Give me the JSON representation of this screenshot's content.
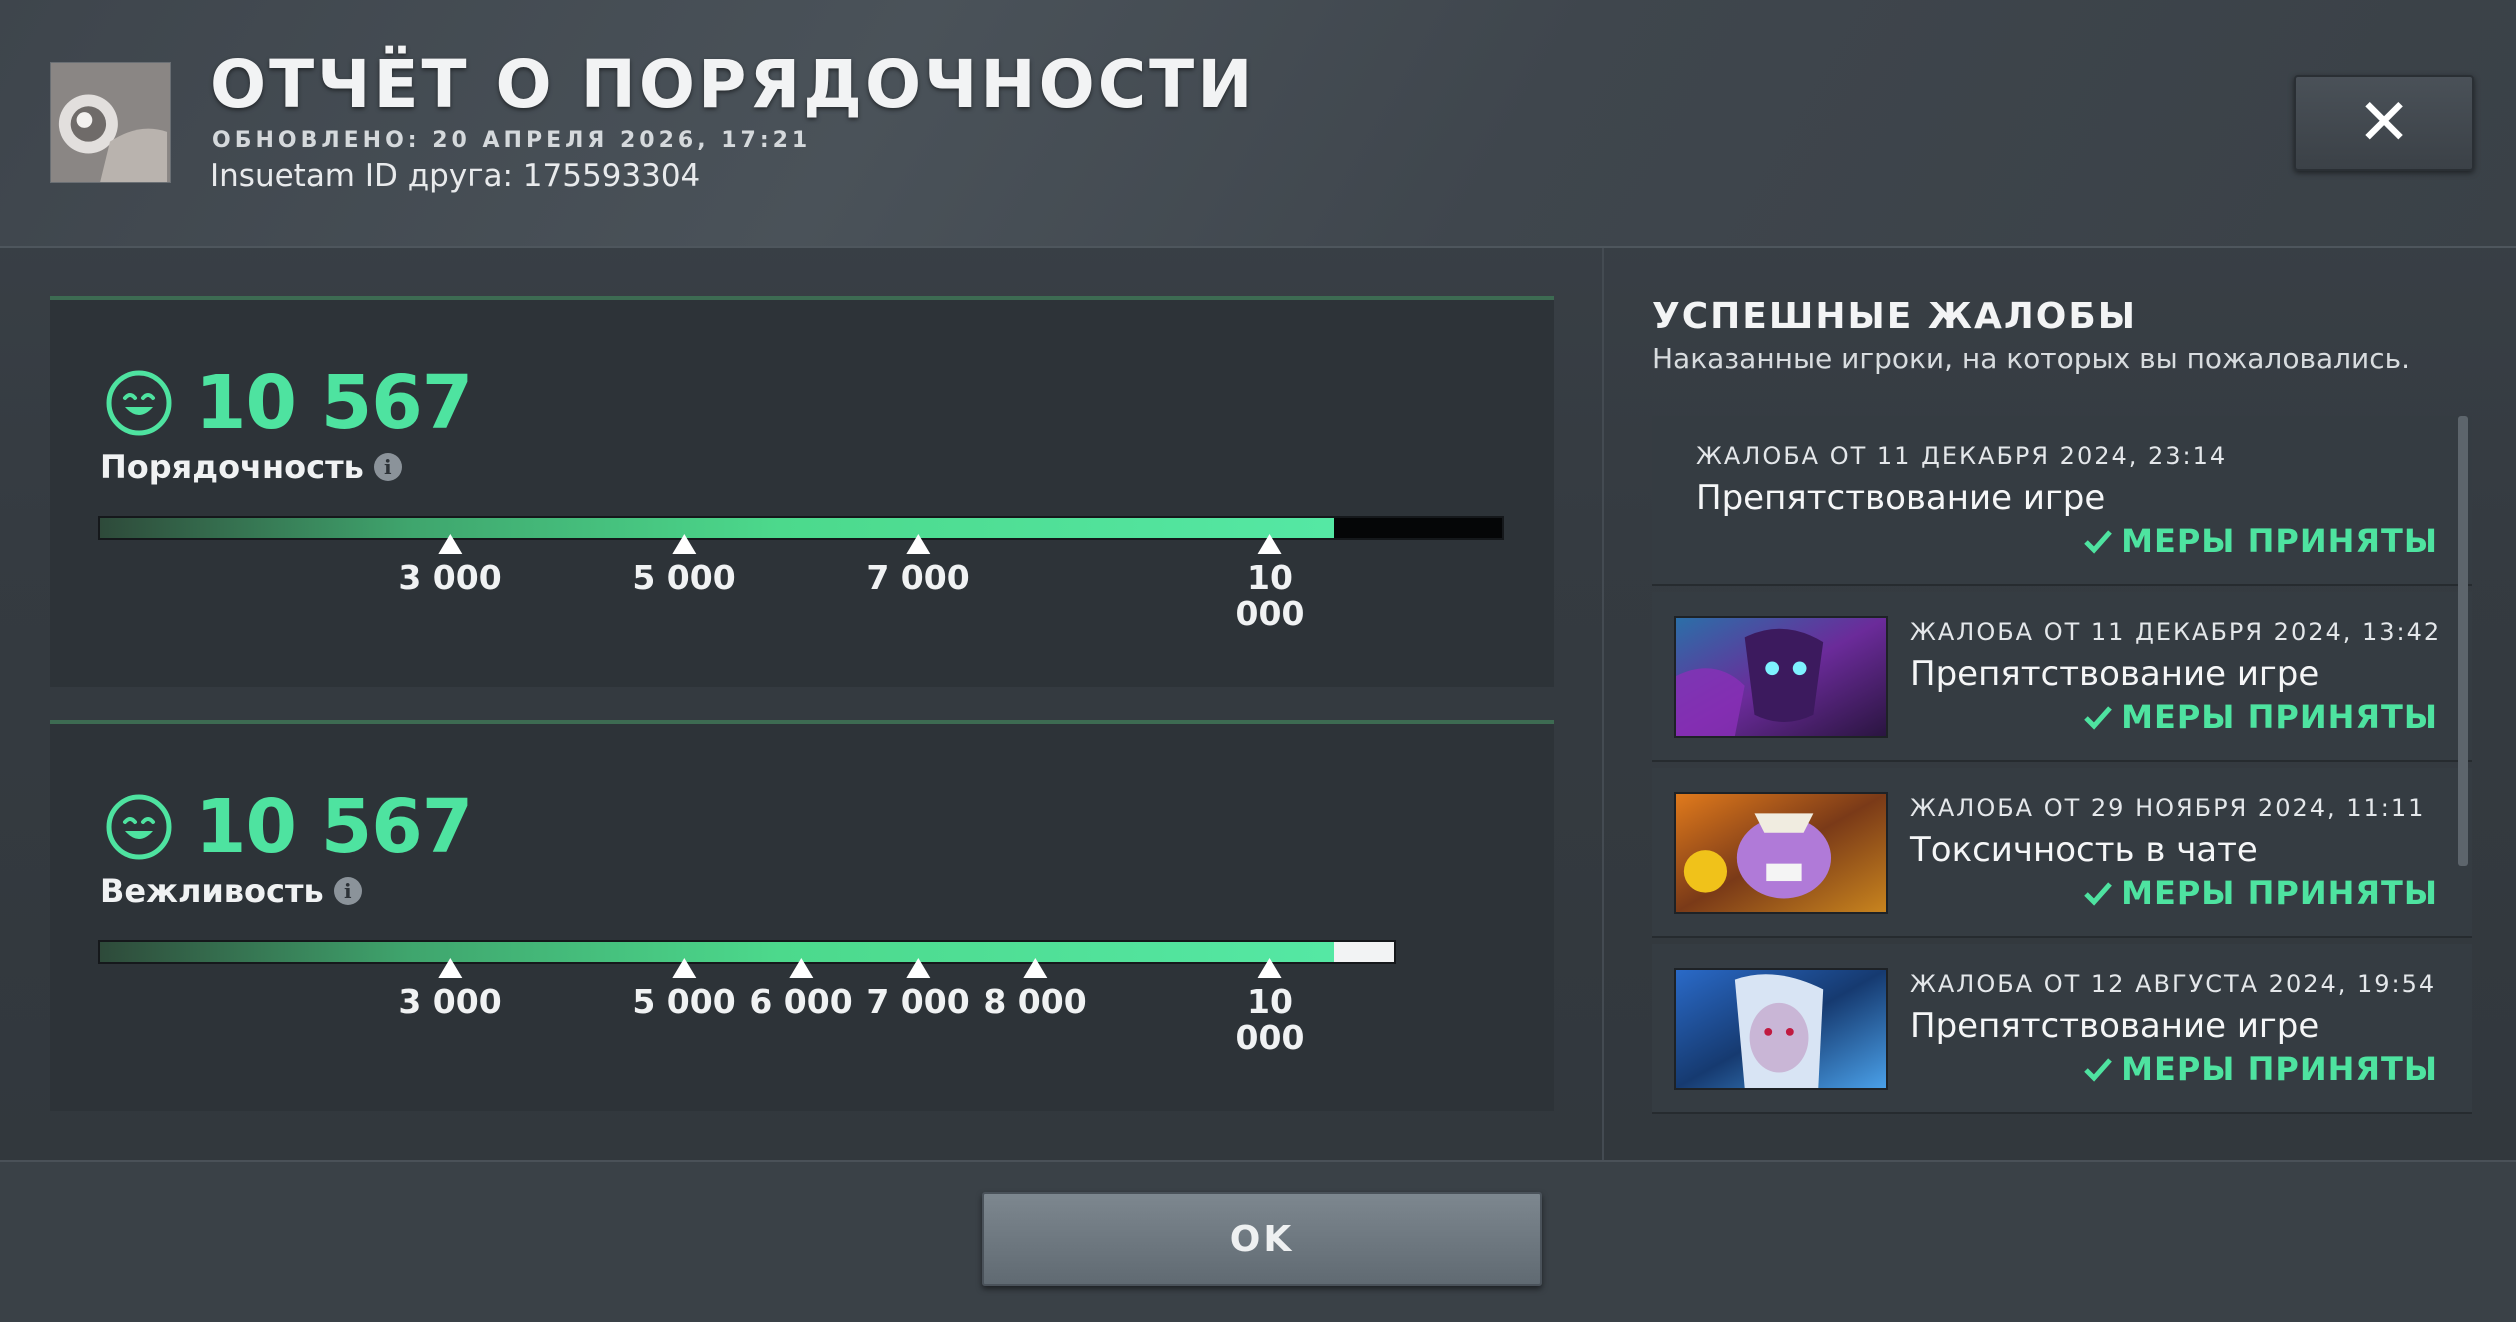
{
  "header": {
    "title": "ОТЧЁТ О ПОРЯДОЧНОСТИ",
    "updated": "ОБНОВЛЕНО: 20 АПРЕЛЯ 2026, 17:21",
    "friend_id": "Insuetam ID друга: 175593304",
    "close_label": "✕"
  },
  "metrics": [
    {
      "score": "10 567",
      "label": "Порядочность",
      "value": 10567,
      "bar_fill_fraction": 0.88,
      "ticks": [
        "3 000",
        "5 000",
        "7 000",
        "10\n000"
      ]
    },
    {
      "score": "10 567",
      "label": "Вежливость",
      "value": 10567,
      "bar_fill_fraction": 0.954,
      "ticks": [
        "3 000",
        "5 000",
        "6 000",
        "7 000",
        "8 000",
        "10\n000"
      ]
    }
  ],
  "reports_section": {
    "title": "УСПЕШНЫЕ ЖАЛОБЫ",
    "subtitle": "Наказанные игроки, на которых вы пожаловались.",
    "items": [
      {
        "date": "ЖАЛОБА ОТ 11 ДЕКАБРЯ 2024, 23:14",
        "reason": "Препятствование игре",
        "status": "МЕРЫ ПРИНЯТЫ",
        "has_thumb": false
      },
      {
        "date": "ЖАЛОБА ОТ 11 ДЕКАБРЯ 2024, 13:42",
        "reason": "Препятствование игре",
        "status": "МЕРЫ ПРИНЯТЫ",
        "has_thumb": true
      },
      {
        "date": "ЖАЛОБА ОТ 29 НОЯБРЯ 2024, 11:11",
        "reason": "Токсичность в чате",
        "status": "МЕРЫ ПРИНЯТЫ",
        "has_thumb": true
      },
      {
        "date": "ЖАЛОБА ОТ 12 АВГУСТА 2024, 19:54",
        "reason": "Препятствование игре",
        "status": "МЕРЫ ПРИНЯТЫ",
        "has_thumb": true
      }
    ]
  },
  "footer": {
    "ok_label": "OK"
  },
  "colors": {
    "accent_green": "#4ee3a0",
    "panel_bg": "#2d3338"
  },
  "icons": [
    "smile-icon",
    "info-icon",
    "check-icon",
    "close-icon"
  ]
}
